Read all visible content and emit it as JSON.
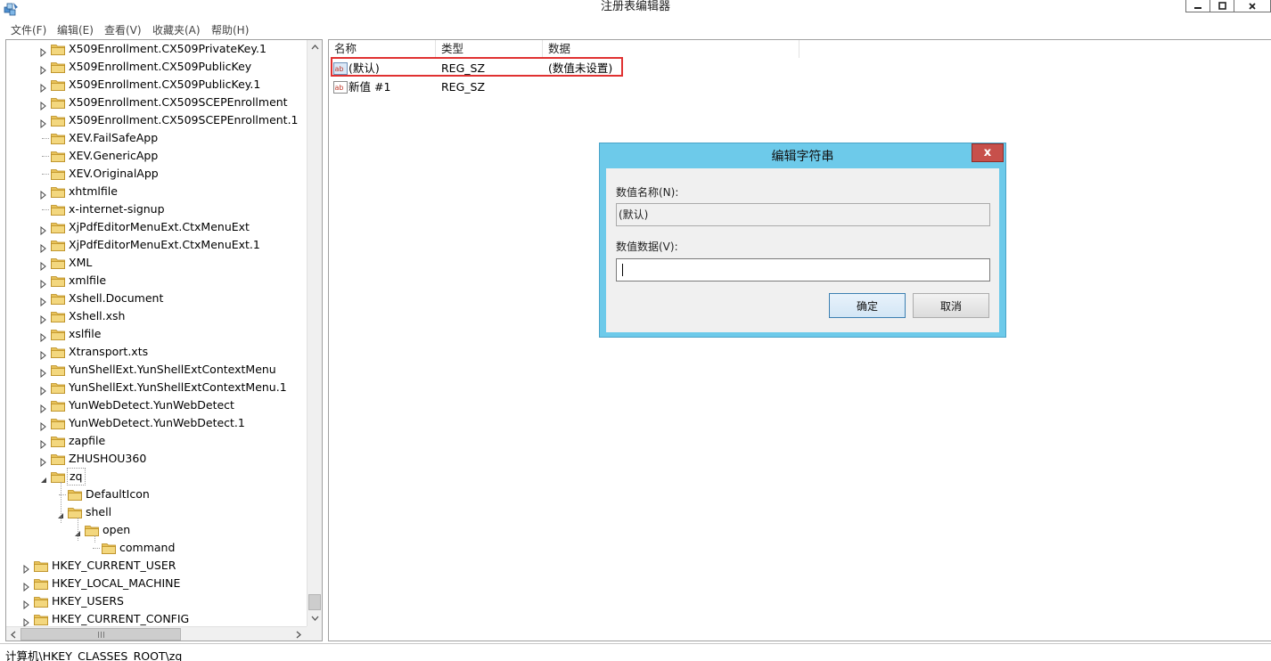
{
  "window": {
    "title": "注册表编辑器"
  },
  "menu": [
    "文件(F)",
    "编辑(E)",
    "查看(V)",
    "收藏夹(A)",
    "帮助(H)"
  ],
  "tree": [
    {
      "label": "X509Enrollment.CX509PrivateKey.1",
      "level": 1,
      "expander": "collapsed"
    },
    {
      "label": "X509Enrollment.CX509PublicKey",
      "level": 1,
      "expander": "collapsed"
    },
    {
      "label": "X509Enrollment.CX509PublicKey.1",
      "level": 1,
      "expander": "collapsed"
    },
    {
      "label": "X509Enrollment.CX509SCEPEnrollment",
      "level": 1,
      "expander": "collapsed"
    },
    {
      "label": "X509Enrollment.CX509SCEPEnrollment.1",
      "level": 1,
      "expander": "collapsed"
    },
    {
      "label": "XEV.FailSafeApp",
      "level": 1,
      "expander": "none"
    },
    {
      "label": "XEV.GenericApp",
      "level": 1,
      "expander": "none"
    },
    {
      "label": "XEV.OriginalApp",
      "level": 1,
      "expander": "none"
    },
    {
      "label": "xhtmlfile",
      "level": 1,
      "expander": "collapsed"
    },
    {
      "label": "x-internet-signup",
      "level": 1,
      "expander": "none"
    },
    {
      "label": "XjPdfEditorMenuExt.CtxMenuExt",
      "level": 1,
      "expander": "collapsed"
    },
    {
      "label": "XjPdfEditorMenuExt.CtxMenuExt.1",
      "level": 1,
      "expander": "collapsed"
    },
    {
      "label": "XML",
      "level": 1,
      "expander": "collapsed"
    },
    {
      "label": "xmlfile",
      "level": 1,
      "expander": "collapsed"
    },
    {
      "label": "Xshell.Document",
      "level": 1,
      "expander": "collapsed"
    },
    {
      "label": "Xshell.xsh",
      "level": 1,
      "expander": "collapsed"
    },
    {
      "label": "xslfile",
      "level": 1,
      "expander": "collapsed"
    },
    {
      "label": "Xtransport.xts",
      "level": 1,
      "expander": "collapsed"
    },
    {
      "label": "YunShellExt.YunShellExtContextMenu",
      "level": 1,
      "expander": "collapsed"
    },
    {
      "label": "YunShellExt.YunShellExtContextMenu.1",
      "level": 1,
      "expander": "collapsed"
    },
    {
      "label": "YunWebDetect.YunWebDetect",
      "level": 1,
      "expander": "collapsed"
    },
    {
      "label": "YunWebDetect.YunWebDetect.1",
      "level": 1,
      "expander": "collapsed"
    },
    {
      "label": "zapfile",
      "level": 1,
      "expander": "collapsed"
    },
    {
      "label": "ZHUSHOU360",
      "level": 1,
      "expander": "collapsed"
    },
    {
      "label": "zq",
      "level": 1,
      "expander": "expanded",
      "selected": true
    },
    {
      "label": "DefaultIcon",
      "level": 2,
      "expander": "none"
    },
    {
      "label": "shell",
      "level": 2,
      "expander": "expanded"
    },
    {
      "label": "open",
      "level": 3,
      "expander": "expanded"
    },
    {
      "label": "command",
      "level": 4,
      "expander": "none"
    },
    {
      "label": "HKEY_CURRENT_USER",
      "level": 0,
      "expander": "collapsed"
    },
    {
      "label": "HKEY_LOCAL_MACHINE",
      "level": 0,
      "expander": "collapsed"
    },
    {
      "label": "HKEY_USERS",
      "level": 0,
      "expander": "collapsed"
    },
    {
      "label": "HKEY_CURRENT_CONFIG",
      "level": 0,
      "expander": "collapsed"
    }
  ],
  "list": {
    "columns": [
      "名称",
      "类型",
      "数据"
    ],
    "rows": [
      {
        "name": "(默认)",
        "type": "REG_SZ",
        "data": "(数值未设置)",
        "icon": "string-value-icon",
        "highlighted": true
      },
      {
        "name": "新值 #1",
        "type": "REG_SZ",
        "data": "",
        "icon": "string-value-icon"
      }
    ]
  },
  "status": {
    "path": "计算机\\HKEY_CLASSES_ROOT\\zq"
  },
  "dialog": {
    "title": "编辑字符串",
    "close_label": "x",
    "name_label": "数值名称(N):",
    "name_value": "(默认)",
    "data_label": "数值数据(V):",
    "data_value": "",
    "ok_label": "确定",
    "cancel_label": "取消"
  },
  "colors": {
    "dialog_frame": "#6dcaea",
    "close_button": "#c7504b",
    "highlight_box": "#e03131",
    "folder": "#e8c25a"
  }
}
